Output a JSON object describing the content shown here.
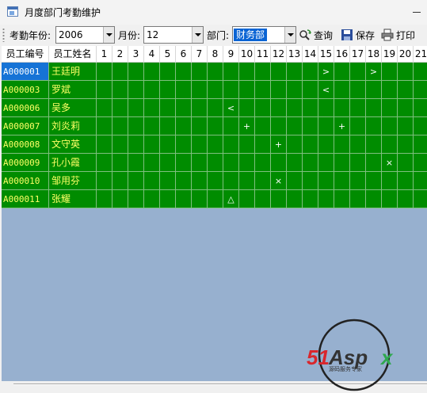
{
  "window": {
    "title": "月度部门考勤维护"
  },
  "toolbar": {
    "year_label": "考勤年份:",
    "year_value": "2006",
    "month_label": "月份:",
    "month_value": "12",
    "dept_label": "部门:",
    "dept_value": "财务部",
    "query_label": "查询",
    "save_label": "保存",
    "print_label": "打印"
  },
  "grid": {
    "col_code": "员工编号",
    "col_name": "员工姓名",
    "days": [
      "1",
      "2",
      "3",
      "4",
      "5",
      "6",
      "7",
      "8",
      "9",
      "10",
      "11",
      "12",
      "13",
      "14",
      "15",
      "16",
      "17",
      "18",
      "19",
      "20",
      "21"
    ],
    "rows": [
      {
        "code": "A000001",
        "name": "王廷明",
        "marks": {
          "15": ">",
          "18": ">"
        }
      },
      {
        "code": "A000003",
        "name": "罗斌",
        "marks": {
          "15": "<"
        }
      },
      {
        "code": "A000006",
        "name": "吴多",
        "marks": {
          "9": "<"
        }
      },
      {
        "code": "A000007",
        "name": "刘炎莉",
        "marks": {
          "10": "+",
          "16": "+"
        }
      },
      {
        "code": "A000008",
        "name": "文守英",
        "marks": {
          "12": "+"
        }
      },
      {
        "code": "A000009",
        "name": "孔小霞",
        "marks": {
          "19": "×"
        }
      },
      {
        "code": "A000010",
        "name": "邹用芬",
        "marks": {
          "12": "×"
        }
      },
      {
        "code": "A000011",
        "name": "张耀",
        "marks": {
          "9": "△"
        }
      }
    ]
  },
  "watermark": {
    "brand": "51Aspx",
    "subtitle": "源码服务专家"
  },
  "colors": {
    "grid_bg": "#008c00",
    "grid_text": "#ffff66",
    "empty_bg": "#97b0cf",
    "selected": "#1673d6"
  }
}
